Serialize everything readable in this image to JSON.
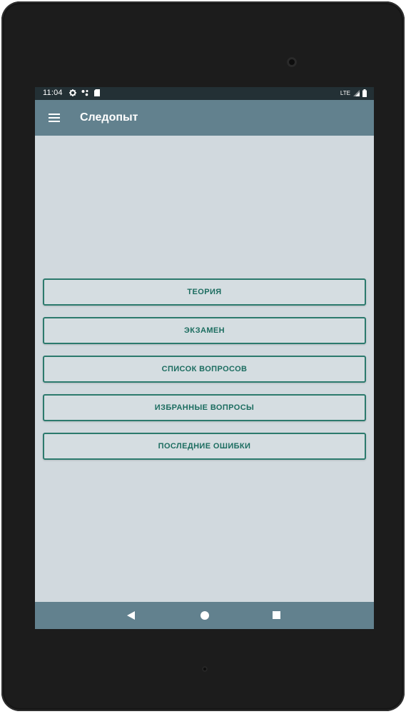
{
  "status_bar": {
    "time": "11:04",
    "network": "LTE"
  },
  "app_bar": {
    "title": "Следопыт",
    "menu_icon": "hamburger-menu-icon"
  },
  "menu": {
    "buttons": [
      {
        "label": "ТЕОРИЯ"
      },
      {
        "label": "ЭКЗАМЕН"
      },
      {
        "label": "СПИСОК ВОПРОСОВ"
      },
      {
        "label": "ИЗБРАННЫЕ ВОПРОСЫ"
      },
      {
        "label": "ПОСЛЕДНИЕ ОШИБКИ"
      }
    ]
  },
  "nav_bar": {
    "icons": [
      "back-icon",
      "home-icon",
      "recents-icon"
    ]
  },
  "colors": {
    "app_bar": "#62818e",
    "background": "#d1d9de",
    "button_border": "#2c7a6d",
    "button_text": "#1c6d60",
    "status_bar": "#233035"
  }
}
